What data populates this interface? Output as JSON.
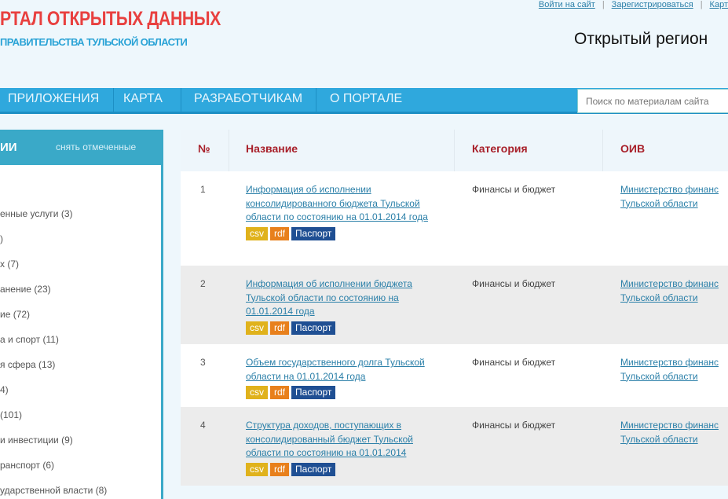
{
  "header": {
    "logo_title": "РТАЛ ОТКРЫТЫХ ДАННЫХ",
    "logo_subtitle": "ПРАВИТЕЛЬСТВА ТУЛЬСКОЙ ОБЛАСТИ",
    "region": "Открытый регион",
    "top_links": [
      "Войти на сайт",
      "Зарегистрироваться",
      "Карт"
    ]
  },
  "nav": {
    "items": [
      "ПРИЛОЖЕНИЯ",
      "КАРТА",
      "РАЗРАБОТЧИКАМ",
      "О ПОРТАЛЕ"
    ],
    "search_placeholder": "Поиск по материалам сайта"
  },
  "sidebar": {
    "title": "ИИ",
    "uncheck": "снять отмеченные",
    "items": [
      "енные услуги (3)",
      ")",
      "х (7)",
      "анение (23)",
      "ие (72)",
      "а и спорт (11)",
      "я сфера (13)",
      "4)",
      "(101)",
      "и инвестиции (9)",
      "ранспорт (6)",
      "ударственной власти (8)"
    ]
  },
  "table": {
    "headers": [
      "№",
      "Название",
      "Категория",
      "ОИВ"
    ],
    "badges": {
      "csv": "csv",
      "rdf": "rdf",
      "passport": "Паспорт"
    },
    "rows": [
      {
        "num": "1",
        "title": "Информация об исполнении консолидированного бюджета Тульской области по состоянию на 01.01.2014 года",
        "category": "Финансы и бюджет",
        "oiv1": "Министерство финанс",
        "oiv2": "Тульской области"
      },
      {
        "num": "2",
        "title": "Информация об исполнении бюджета Тульской области по состоянию на 01.01.2014 года",
        "category": "Финансы и бюджет",
        "oiv1": "Министерство финанс",
        "oiv2": "Тульской области"
      },
      {
        "num": "3",
        "title": "Объем государственного долга Тульской области на 01.01.2014 года",
        "category": "Финансы и бюджет",
        "oiv1": "Министерство финанс",
        "oiv2": "Тульской области"
      },
      {
        "num": "4",
        "title": "Структура доходов, поступающих в консолидированный бюджет Тульской области по состоянию на 01.01.2014",
        "category": "Финансы и бюджет",
        "oiv1": "Министерство финанс",
        "oiv2": "Тульской области"
      }
    ]
  },
  "colors": {
    "accent_red": "#e8403f",
    "nav_blue": "#2fa8dd",
    "sidebar_teal": "#3aa9c8",
    "csv": "#e0b21c",
    "rdf": "#e8801c",
    "passport": "#1f4f93"
  }
}
